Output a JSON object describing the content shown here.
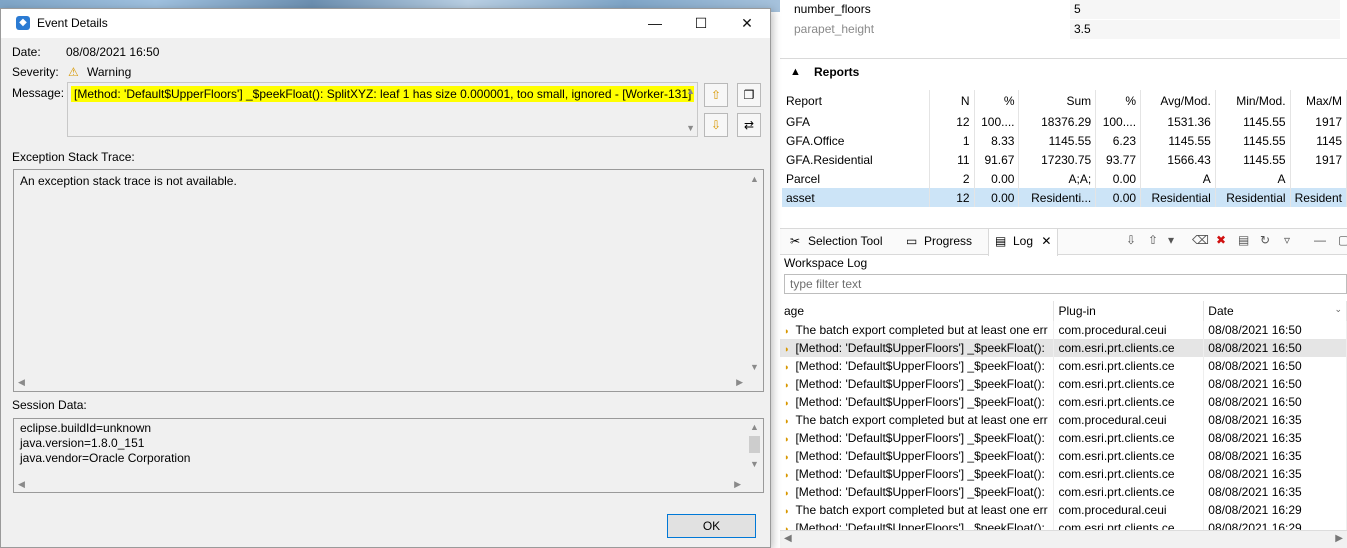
{
  "attributes": [
    {
      "name": "number_floors",
      "value": "5",
      "muted": false
    },
    {
      "name": "parapet_height",
      "value": "3.5",
      "muted": true
    }
  ],
  "reports": {
    "title": "Reports",
    "columns": [
      "Report",
      "N",
      "%",
      "Sum",
      "%",
      "Avg/Mod.",
      "Min/Mod.",
      "Max/M"
    ],
    "rows": [
      [
        "GFA",
        "12",
        "100....",
        "18376.29",
        "100....",
        "1531.36",
        "1145.55",
        "1917"
      ],
      [
        "GFA.Office",
        "1",
        "8.33",
        "1145.55",
        "6.23",
        "1145.55",
        "1145.55",
        "1145"
      ],
      [
        "GFA.Residential",
        "11",
        "91.67",
        "17230.75",
        "93.77",
        "1566.43",
        "1145.55",
        "1917"
      ],
      [
        "Parcel",
        "2",
        "0.00",
        "A;A;",
        "0.00",
        "A",
        "A",
        ""
      ],
      [
        "asset",
        "12",
        "0.00",
        "Residenti...",
        "0.00",
        "Residential",
        "Residential",
        "Resident"
      ]
    ],
    "selected_row": 4
  },
  "log_view": {
    "tabs": [
      {
        "label": "Selection Tool",
        "icon": "✂"
      },
      {
        "label": "Progress",
        "icon": "▭"
      },
      {
        "label": "Log",
        "icon": "▤"
      }
    ],
    "workspace_label": "Workspace Log",
    "filter_placeholder": "type filter text",
    "columns": [
      "age",
      "Plug-in",
      "Date"
    ],
    "rows": [
      [
        "The batch export completed but at least one err",
        "com.procedural.ceui",
        "08/08/2021 16:50"
      ],
      [
        "[Method: 'Default$UpperFloors'] _$peekFloat():",
        "com.esri.prt.clients.ce",
        "08/08/2021 16:50"
      ],
      [
        "[Method: 'Default$UpperFloors'] _$peekFloat():",
        "com.esri.prt.clients.ce",
        "08/08/2021 16:50"
      ],
      [
        "[Method: 'Default$UpperFloors'] _$peekFloat():",
        "com.esri.prt.clients.ce",
        "08/08/2021 16:50"
      ],
      [
        "[Method: 'Default$UpperFloors'] _$peekFloat():",
        "com.esri.prt.clients.ce",
        "08/08/2021 16:50"
      ],
      [
        "The batch export completed but at least one err",
        "com.procedural.ceui",
        "08/08/2021 16:35"
      ],
      [
        "[Method: 'Default$UpperFloors'] _$peekFloat():",
        "com.esri.prt.clients.ce",
        "08/08/2021 16:35"
      ],
      [
        "[Method: 'Default$UpperFloors'] _$peekFloat():",
        "com.esri.prt.clients.ce",
        "08/08/2021 16:35"
      ],
      [
        "[Method: 'Default$UpperFloors'] _$peekFloat():",
        "com.esri.prt.clients.ce",
        "08/08/2021 16:35"
      ],
      [
        "[Method: 'Default$UpperFloors'] _$peekFloat():",
        "com.esri.prt.clients.ce",
        "08/08/2021 16:35"
      ],
      [
        "The batch export completed but at least one err",
        "com.procedural.ceui",
        "08/08/2021 16:29"
      ],
      [
        "[Method: 'Default$UpperFloors'] _$peekFloat():",
        "com.esri.prt.clients.ce",
        "08/08/2021 16:29"
      ]
    ],
    "selected_row": 1
  },
  "dialog": {
    "title": "Event Details",
    "date_label": "Date:",
    "date_value": "08/08/2021 16:50",
    "severity_label": "Severity:",
    "severity_value": "Warning",
    "message_label": "Message:",
    "message_text": "[Method: 'Default$UpperFloors'] _$peekFloat(): SplitXYZ: leaf 1 has size 0.000001, too small, ignored - [Worker-131]",
    "trace_label": "Exception Stack Trace:",
    "trace_text": "An exception stack trace is not available.",
    "session_label": "Session Data:",
    "session_lines": [
      "eclipse.buildId=unknown",
      "java.version=1.8.0_151",
      "java.vendor=Oracle Corporation"
    ],
    "ok_label": "OK",
    "highlight_color": "#ffff00"
  }
}
